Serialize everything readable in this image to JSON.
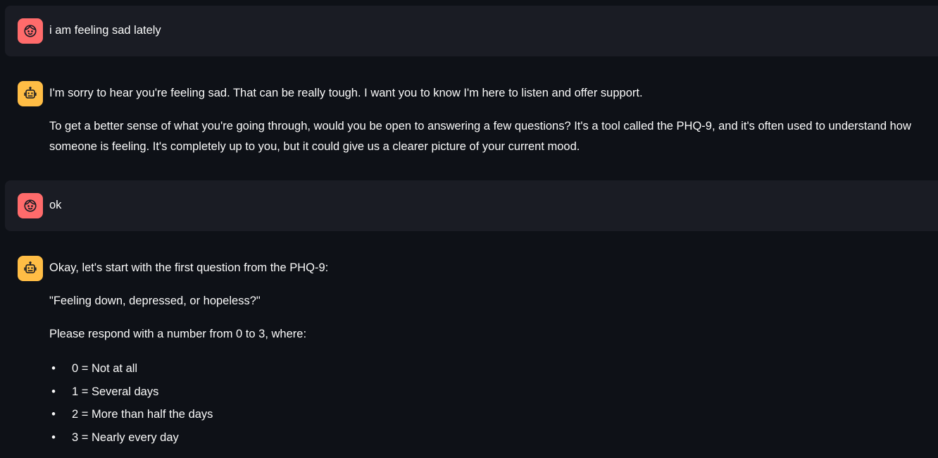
{
  "colors": {
    "background": "#0e1117",
    "user_bubble": "#1a1c24",
    "user_avatar": "#ff6b6b",
    "assistant_avatar": "#ffbd45",
    "text": "#fafafa"
  },
  "messages": [
    {
      "role": "user",
      "avatar_icon": "user-face-icon",
      "paragraphs": [
        "i am feeling sad lately"
      ]
    },
    {
      "role": "assistant",
      "avatar_icon": "robot-icon",
      "paragraphs": [
        "I'm sorry to hear you're feeling sad. That can be really tough. I want you to know I'm here to listen and offer support.",
        "To get a better sense of what you're going through, would you be open to answering a few questions? It's a tool called the PHQ-9, and it's often used to understand how someone is feeling. It's completely up to you, but it could give us a clearer picture of your current mood."
      ]
    },
    {
      "role": "user",
      "avatar_icon": "user-face-icon",
      "paragraphs": [
        "ok"
      ]
    },
    {
      "role": "assistant",
      "avatar_icon": "robot-icon",
      "paragraphs": [
        "Okay, let's start with the first question from the PHQ-9:",
        "\"Feeling down, depressed, or hopeless?\"",
        "Please respond with a number from 0 to 3, where:"
      ],
      "list": [
        "0 = Not at all",
        "1 = Several days",
        "2 = More than half the days",
        "3 = Nearly every day"
      ]
    }
  ]
}
